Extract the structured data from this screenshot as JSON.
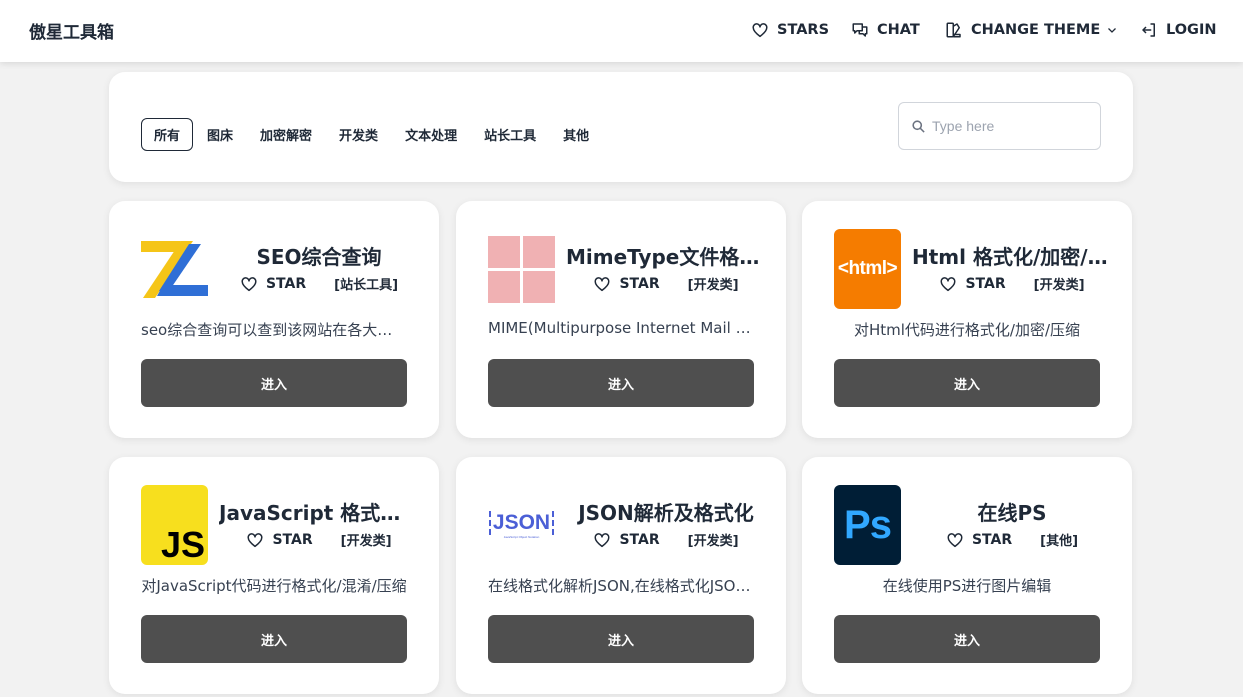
{
  "navbar": {
    "brand": "傲星工具箱",
    "items": [
      {
        "label": "STARS",
        "icon": "heart-icon"
      },
      {
        "label": "CHAT",
        "icon": "chat-icon"
      },
      {
        "label": "CHANGE THEME",
        "icon": "theme-icon"
      },
      {
        "label": "LOGIN",
        "icon": "login-icon"
      }
    ]
  },
  "filter": {
    "tabs": [
      "所有",
      "图床",
      "加密解密",
      "开发类",
      "文本处理",
      "站长工具",
      "其他"
    ],
    "active_tab": "所有",
    "search_placeholder": "Type here"
  },
  "star_label": "STAR",
  "enter_label": "进入",
  "tools": [
    {
      "title": "SEO综合查询",
      "category": "[站长工具]",
      "desc": "seo综合查询可以查到该网站在各大搜索引擎的信息",
      "logo": "seo-z-logo"
    },
    {
      "title": "MimeType文件格式大全",
      "category": "[开发类]",
      "desc": "MIME(Multipurpose Internet Mail Extensions)",
      "logo": "mime-grid-logo"
    },
    {
      "title": "Html 格式化/加密/压缩",
      "category": "[开发类]",
      "desc": "对Html代码进行格式化/加密/压缩",
      "logo": "html-logo"
    },
    {
      "title": "JavaScript 格式化/混淆/压缩",
      "category": "[开发类]",
      "desc": "对JavaScript代码进行格式化/混淆/压缩",
      "logo": "js-logo"
    },
    {
      "title": "JSON解析及格式化",
      "category": "[开发类]",
      "desc": "在线格式化解析JSON,在线格式化JSON数据",
      "logo": "json-logo"
    },
    {
      "title": "在线PS",
      "category": "[其他]",
      "desc": "在线使用PS进行图片编辑",
      "logo": "ps-logo"
    }
  ],
  "logo_texts": {
    "html": "<html>",
    "js": "JS",
    "json": "JSON",
    "json_sub": "JavaScript Object Notation",
    "ps": "Ps"
  },
  "colors": {
    "enter_button": "#4f4f4f",
    "html_logo_bg": "#f57c00",
    "js_logo_bg": "#f7df1e",
    "ps_logo_bg": "#001e36",
    "ps_logo_fg": "#31a8ff",
    "mime_logo": "#f0b1b3",
    "json_logo": "#4b5fd6"
  }
}
